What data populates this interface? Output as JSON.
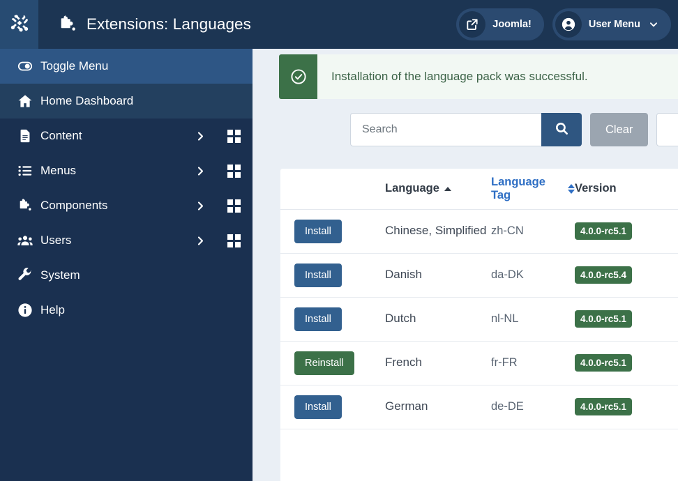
{
  "header": {
    "logo_icon": "joomla-logo-icon",
    "title_icon": "puzzle-piece-icon",
    "title": "Extensions: Languages",
    "site_button": {
      "label": "Joomla!",
      "icon": "external-link-icon"
    },
    "user_menu": {
      "label": "User Menu",
      "icon": "user-circle-icon",
      "caret": "chevron-down-icon"
    }
  },
  "sidebar": {
    "items": [
      {
        "label": "Toggle Menu",
        "icon": "toggle-switch-icon",
        "state": "active",
        "has_chevron": false,
        "has_grid": false
      },
      {
        "label": "Home Dashboard",
        "icon": "home-icon",
        "state": "semi",
        "has_chevron": false,
        "has_grid": false
      },
      {
        "label": "Content",
        "icon": "document-icon",
        "state": "normal",
        "has_chevron": true,
        "has_grid": true
      },
      {
        "label": "Menus",
        "icon": "list-icon",
        "state": "normal",
        "has_chevron": true,
        "has_grid": true
      },
      {
        "label": "Components",
        "icon": "puzzle-piece-icon",
        "state": "normal",
        "has_chevron": true,
        "has_grid": true
      },
      {
        "label": "Users",
        "icon": "users-icon",
        "state": "normal",
        "has_chevron": true,
        "has_grid": true
      },
      {
        "label": "System",
        "icon": "wrench-icon",
        "state": "normal",
        "has_chevron": false,
        "has_grid": false
      },
      {
        "label": "Help",
        "icon": "info-circle-icon",
        "state": "normal",
        "has_chevron": false,
        "has_grid": false
      }
    ]
  },
  "alert": {
    "icon": "check-circle-icon",
    "message": "Installation of the language pack was successful."
  },
  "toolbar": {
    "search_placeholder": "Search",
    "search_value": "",
    "search_icon": "search-icon",
    "clear_label": "Clear"
  },
  "table": {
    "columns": [
      {
        "key": "action",
        "label": ""
      },
      {
        "key": "language",
        "label": "Language",
        "sort": "asc",
        "active": true
      },
      {
        "key": "tag",
        "label": "Language Tag",
        "sort": "none",
        "active": false
      },
      {
        "key": "version",
        "label": "Version",
        "sort": "none",
        "active": false
      }
    ],
    "rows": [
      {
        "action": "Install",
        "action_type": "install",
        "language": "Chinese, Simplified",
        "tag": "zh-CN",
        "version": "4.0.0-rc5.1"
      },
      {
        "action": "Install",
        "action_type": "install",
        "language": "Danish",
        "tag": "da-DK",
        "version": "4.0.0-rc5.4"
      },
      {
        "action": "Install",
        "action_type": "install",
        "language": "Dutch",
        "tag": "nl-NL",
        "version": "4.0.0-rc5.1"
      },
      {
        "action": "Reinstall",
        "action_type": "reinstall",
        "language": "French",
        "tag": "fr-FR",
        "version": "4.0.0-rc5.1"
      },
      {
        "action": "Install",
        "action_type": "install",
        "language": "German",
        "tag": "de-DE",
        "version": "4.0.0-rc5.1"
      }
    ]
  },
  "colors": {
    "header_bg": "#1c3553",
    "sidebar_bg": "#1a3050",
    "sidebar_active": "#2e5685",
    "accent_blue": "#2f5681",
    "success_green": "#3c7148",
    "content_bg": "#eaeff5"
  }
}
